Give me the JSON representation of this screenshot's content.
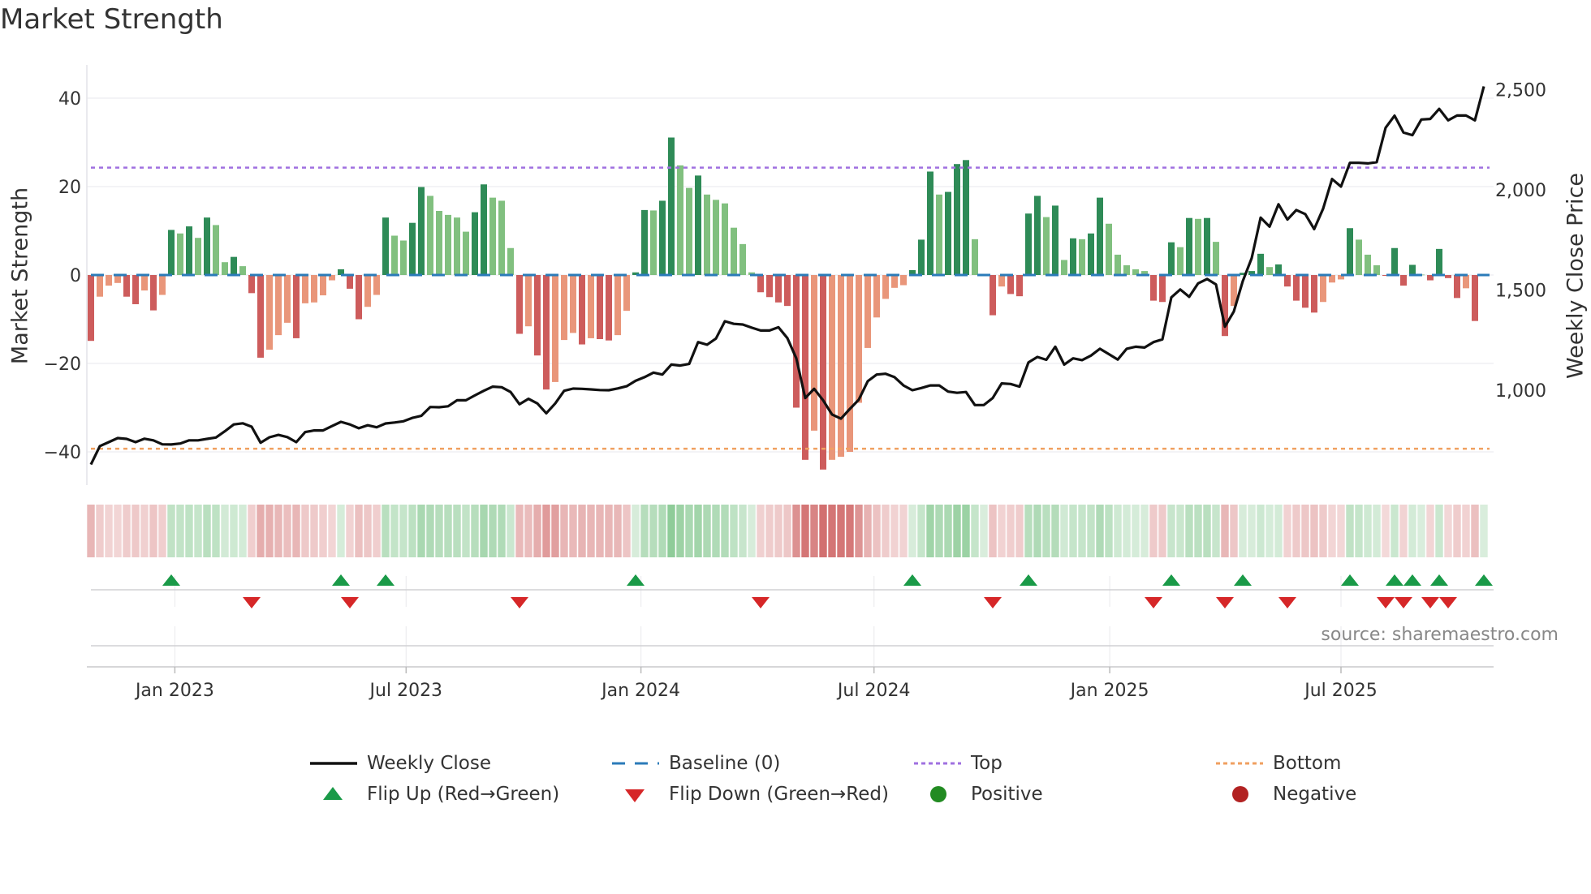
{
  "chart_data": {
    "type": "bar",
    "title": "Market Strength",
    "ylabel": "Market Strength",
    "y2label": "Weekly Close Price",
    "ylim": [
      -45,
      45
    ],
    "y2lim": [
      560,
      2600
    ],
    "yticks": [
      {
        "v": 40,
        "label": "40"
      },
      {
        "v": 20,
        "label": "20"
      },
      {
        "v": 0,
        "label": "0"
      },
      {
        "v": -20,
        "label": "−20"
      },
      {
        "v": -40,
        "label": "−40"
      }
    ],
    "y2ticks": [
      {
        "v": 2500,
        "label": "2,500"
      },
      {
        "v": 2000,
        "label": "2,000"
      },
      {
        "v": 1500,
        "label": "1,500"
      },
      {
        "v": 1000,
        "label": "1,000"
      }
    ],
    "xticks": [
      {
        "week": 9.4,
        "label": "Jan 2023"
      },
      {
        "week": 35.3,
        "label": "Jul 2023"
      },
      {
        "week": 61.6,
        "label": "Jan 2024"
      },
      {
        "week": 87.7,
        "label": "Jul 2024"
      },
      {
        "week": 114.1,
        "label": "Jan 2025"
      },
      {
        "week": 140.0,
        "label": "Jul 2025"
      }
    ],
    "top_level": 24.3,
    "bottom_level": -39.3,
    "baseline": 0,
    "strength": [
      -14.9,
      -4.9,
      -2.4,
      -1.8,
      -4.9,
      -6.6,
      -3.5,
      -8.0,
      -4.5,
      10.2,
      9.4,
      11.0,
      8.4,
      13.0,
      11.3,
      2.9,
      4.1,
      2.0,
      -4.1,
      -18.7,
      -16.9,
      -13.6,
      -10.8,
      -14.3,
      -6.4,
      -6.2,
      -4.6,
      -1.2,
      1.3,
      -3.1,
      -10.0,
      -7.2,
      -4.5,
      13.0,
      8.9,
      7.8,
      11.8,
      19.9,
      17.9,
      14.5,
      13.6,
      13.0,
      9.8,
      14.2,
      20.5,
      17.5,
      16.8,
      6.1,
      -13.3,
      -11.6,
      -18.2,
      -25.9,
      -24.2,
      -14.7,
      -13.1,
      -15.7,
      -14.3,
      -14.5,
      -14.8,
      -13.6,
      -8.1,
      0.6,
      14.7,
      14.6,
      16.8,
      31.1,
      24.8,
      19.7,
      22.5,
      18.2,
      17.0,
      16.2,
      10.7,
      7.0,
      0.6,
      -3.9,
      -5.0,
      -6.2,
      -7.0,
      -30.0,
      -41.8,
      -35.2,
      -44.0,
      -41.8,
      -41.1,
      -40.0,
      -28.9,
      -16.5,
      -9.6,
      -5.4,
      -2.9,
      -2.3,
      1.1,
      8.0,
      23.4,
      18.2,
      18.8,
      25.1,
      26.0,
      8.1,
      0.1,
      -9.1,
      -2.6,
      -4.3,
      -4.8,
      13.9,
      17.9,
      13.1,
      15.7,
      3.4,
      8.3,
      8.1,
      9.4,
      17.5,
      11.6,
      4.6,
      2.2,
      1.3,
      0.9,
      -5.8,
      -6.1,
      7.4,
      6.3,
      12.9,
      12.7,
      12.9,
      7.5,
      -13.8,
      -7.0,
      0.5,
      0.9,
      4.8,
      1.8,
      2.4,
      -2.6,
      -5.8,
      -7.4,
      -8.5,
      -6.1,
      -1.7,
      -1.0,
      10.6,
      8.0,
      4.6,
      2.2,
      -0.2,
      6.1,
      -2.4,
      2.3,
      0.1,
      -1.2,
      5.9,
      -0.7,
      -5.2,
      -3.0,
      -10.4,
      0.2
    ],
    "weekly_close": [
      629,
      721,
      741,
      761,
      757,
      741,
      758,
      750,
      730,
      729,
      734,
      750,
      750,
      757,
      764,
      795,
      829,
      835,
      818,
      738,
      765,
      777,
      766,
      741,
      791,
      799,
      799,
      821,
      842,
      829,
      810,
      825,
      815,
      834,
      839,
      845,
      862,
      872,
      916,
      915,
      920,
      950,
      950,
      974,
      997,
      1018,
      1015,
      991,
      930,
      957,
      934,
      885,
      934,
      997,
      1008,
      1007,
      1004,
      1001,
      1000,
      1009,
      1020,
      1047,
      1065,
      1088,
      1078,
      1128,
      1123,
      1131,
      1240,
      1227,
      1258,
      1344,
      1331,
      1328,
      1312,
      1298,
      1298,
      1314,
      1260,
      1159,
      961,
      1007,
      950,
      879,
      858,
      907,
      953,
      1045,
      1078,
      1082,
      1065,
      1024,
      1000,
      1011,
      1024,
      1024,
      993,
      987,
      991,
      926,
      926,
      961,
      1034,
      1031,
      1018,
      1139,
      1166,
      1152,
      1217,
      1128,
      1159,
      1150,
      1173,
      1207,
      1180,
      1153,
      1207,
      1217,
      1213,
      1240,
      1254,
      1463,
      1503,
      1466,
      1533,
      1555,
      1528,
      1317,
      1393,
      1544,
      1659,
      1861,
      1816,
      1928,
      1852,
      1899,
      1879,
      1804,
      1906,
      2054,
      2016,
      2135,
      2135,
      2132,
      2138,
      2310,
      2370,
      2286,
      2273,
      2351,
      2354,
      2404,
      2347,
      2371,
      2371,
      2347,
      2516
    ],
    "legend": {
      "weekly_close": "Weekly Close",
      "baseline": "Baseline (0)",
      "top": "Top",
      "bottom": "Bottom",
      "flip_up": "Flip Up (Red→Green)",
      "flip_down": "Flip Down (Green→Red)",
      "positive": "Positive",
      "negative": "Negative"
    },
    "legend_placement": "bottom"
  },
  "source": "source: sharemaestro.com",
  "colors": {
    "pos_rising": "#2e8b57",
    "pos_falling": "#81c07f",
    "neg_falling": "#cd5c5c",
    "neg_rising": "#e9967a",
    "baseline": "#2b7bb9",
    "top": "#a070e0",
    "bottom": "#f0a060",
    "flip_up": "#1a9a48",
    "flip_down": "#d62728",
    "positive": "#228b22",
    "negative": "#b22222",
    "line": "#111111"
  }
}
